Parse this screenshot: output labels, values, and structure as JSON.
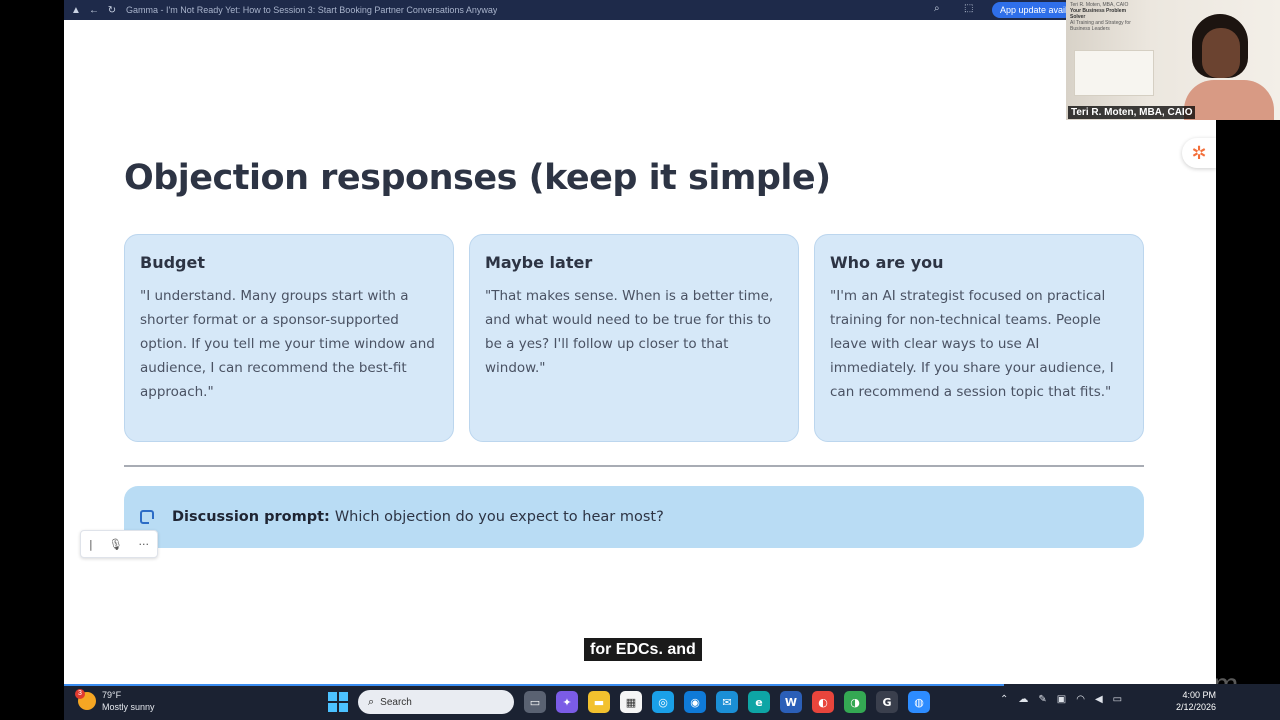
{
  "window": {
    "title": "Gamma - I'm Not Ready Yet: How to Session 3: Start Booking Partner Conversations Anyway",
    "update_button": "App update available"
  },
  "slide": {
    "title": "Objection responses (keep it simple)",
    "cards": [
      {
        "heading": "Budget",
        "body": "\"I understand. Many groups start with a shorter format or a sponsor-supported option. If you tell me your time window and audience, I can recommend the best-fit approach.\""
      },
      {
        "heading": "Maybe later",
        "body": "\"That makes sense. When is a better time, and what would need to be true for this to be a yes? I'll follow up closer to that window.\""
      },
      {
        "heading": "Who are you",
        "body": "\"I'm an AI strategist focused on practical training for non-technical teams. People leave with clear ways to use AI immediately. If you share your audience, I can recommend a session topic that fits.\""
      }
    ],
    "prompt": {
      "label": "Discussion prompt:",
      "text": "Which objection do you expect to hear most?"
    }
  },
  "caption": "for EDCs. and",
  "watermark": "zoom",
  "webcam": {
    "name": "Teri R. Moten, MBA, CAIO",
    "poster_name": "Teri R. Moten, MBA, CAIO",
    "poster_title": "Your Business Problem Solver",
    "poster_sub": "AI Training and Strategy for Business Leaders"
  },
  "taskbar": {
    "weather_temp": "79°F",
    "weather_desc": "Mostly sunny",
    "weather_badge": "3",
    "search_label": "Search",
    "time": "4:00 PM",
    "date": "2/12/2026"
  },
  "colors": {
    "card_bg": "#d6e8f8",
    "prompt_bg": "#b9dcf4",
    "title": "#2d3444",
    "accent": "#2c6cc6"
  }
}
